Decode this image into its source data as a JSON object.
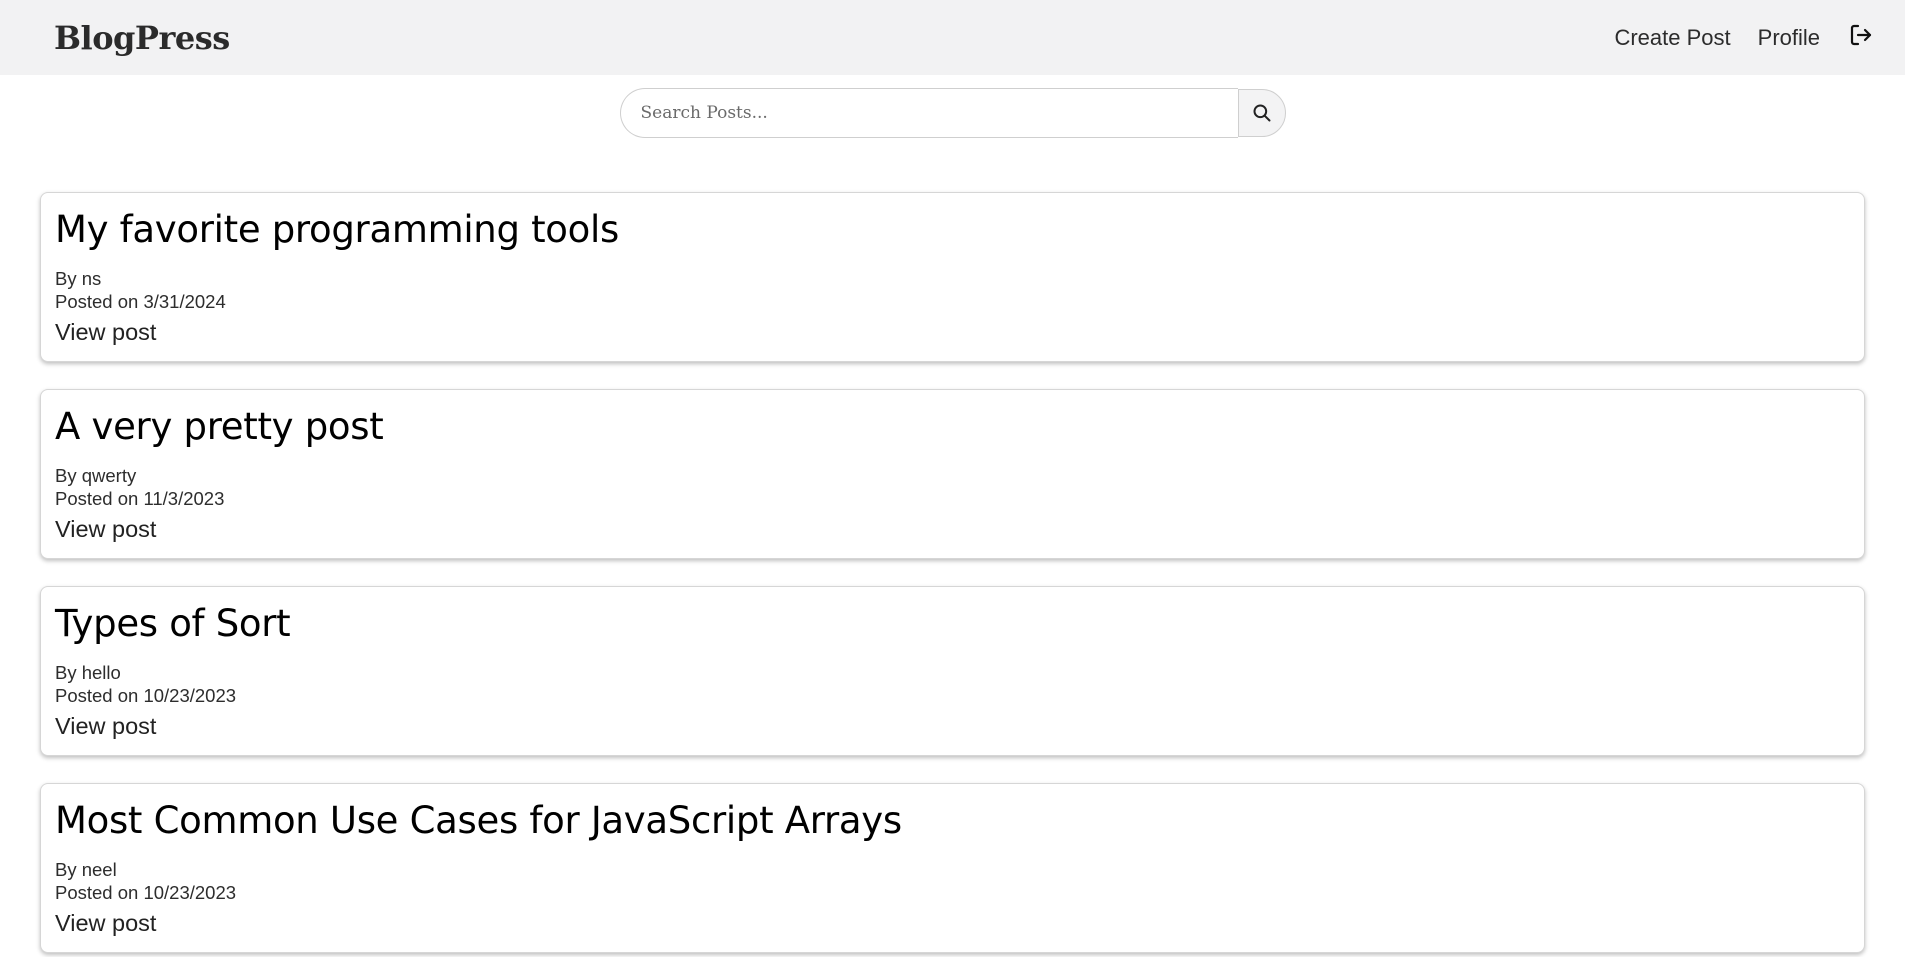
{
  "navbar": {
    "brand": "BlogPress",
    "links": {
      "create_post": "Create Post",
      "profile": "Profile"
    },
    "logout_icon": "logout-icon"
  },
  "search": {
    "placeholder": "Search Posts...",
    "value": "",
    "button_icon": "search-icon"
  },
  "posts": [
    {
      "title": "My favorite programming tools",
      "author": "By ns",
      "date": "Posted on 3/31/2024",
      "link": "View post"
    },
    {
      "title": "A very pretty post",
      "author": "By qwerty",
      "date": "Posted on 11/3/2023",
      "link": "View post"
    },
    {
      "title": "Types of Sort",
      "author": "By hello",
      "date": "Posted on 10/23/2023",
      "link": "View post"
    },
    {
      "title": "Most Common Use Cases for JavaScript Arrays",
      "author": "By neel",
      "date": "Posted on 10/23/2023",
      "link": "View post"
    }
  ]
}
